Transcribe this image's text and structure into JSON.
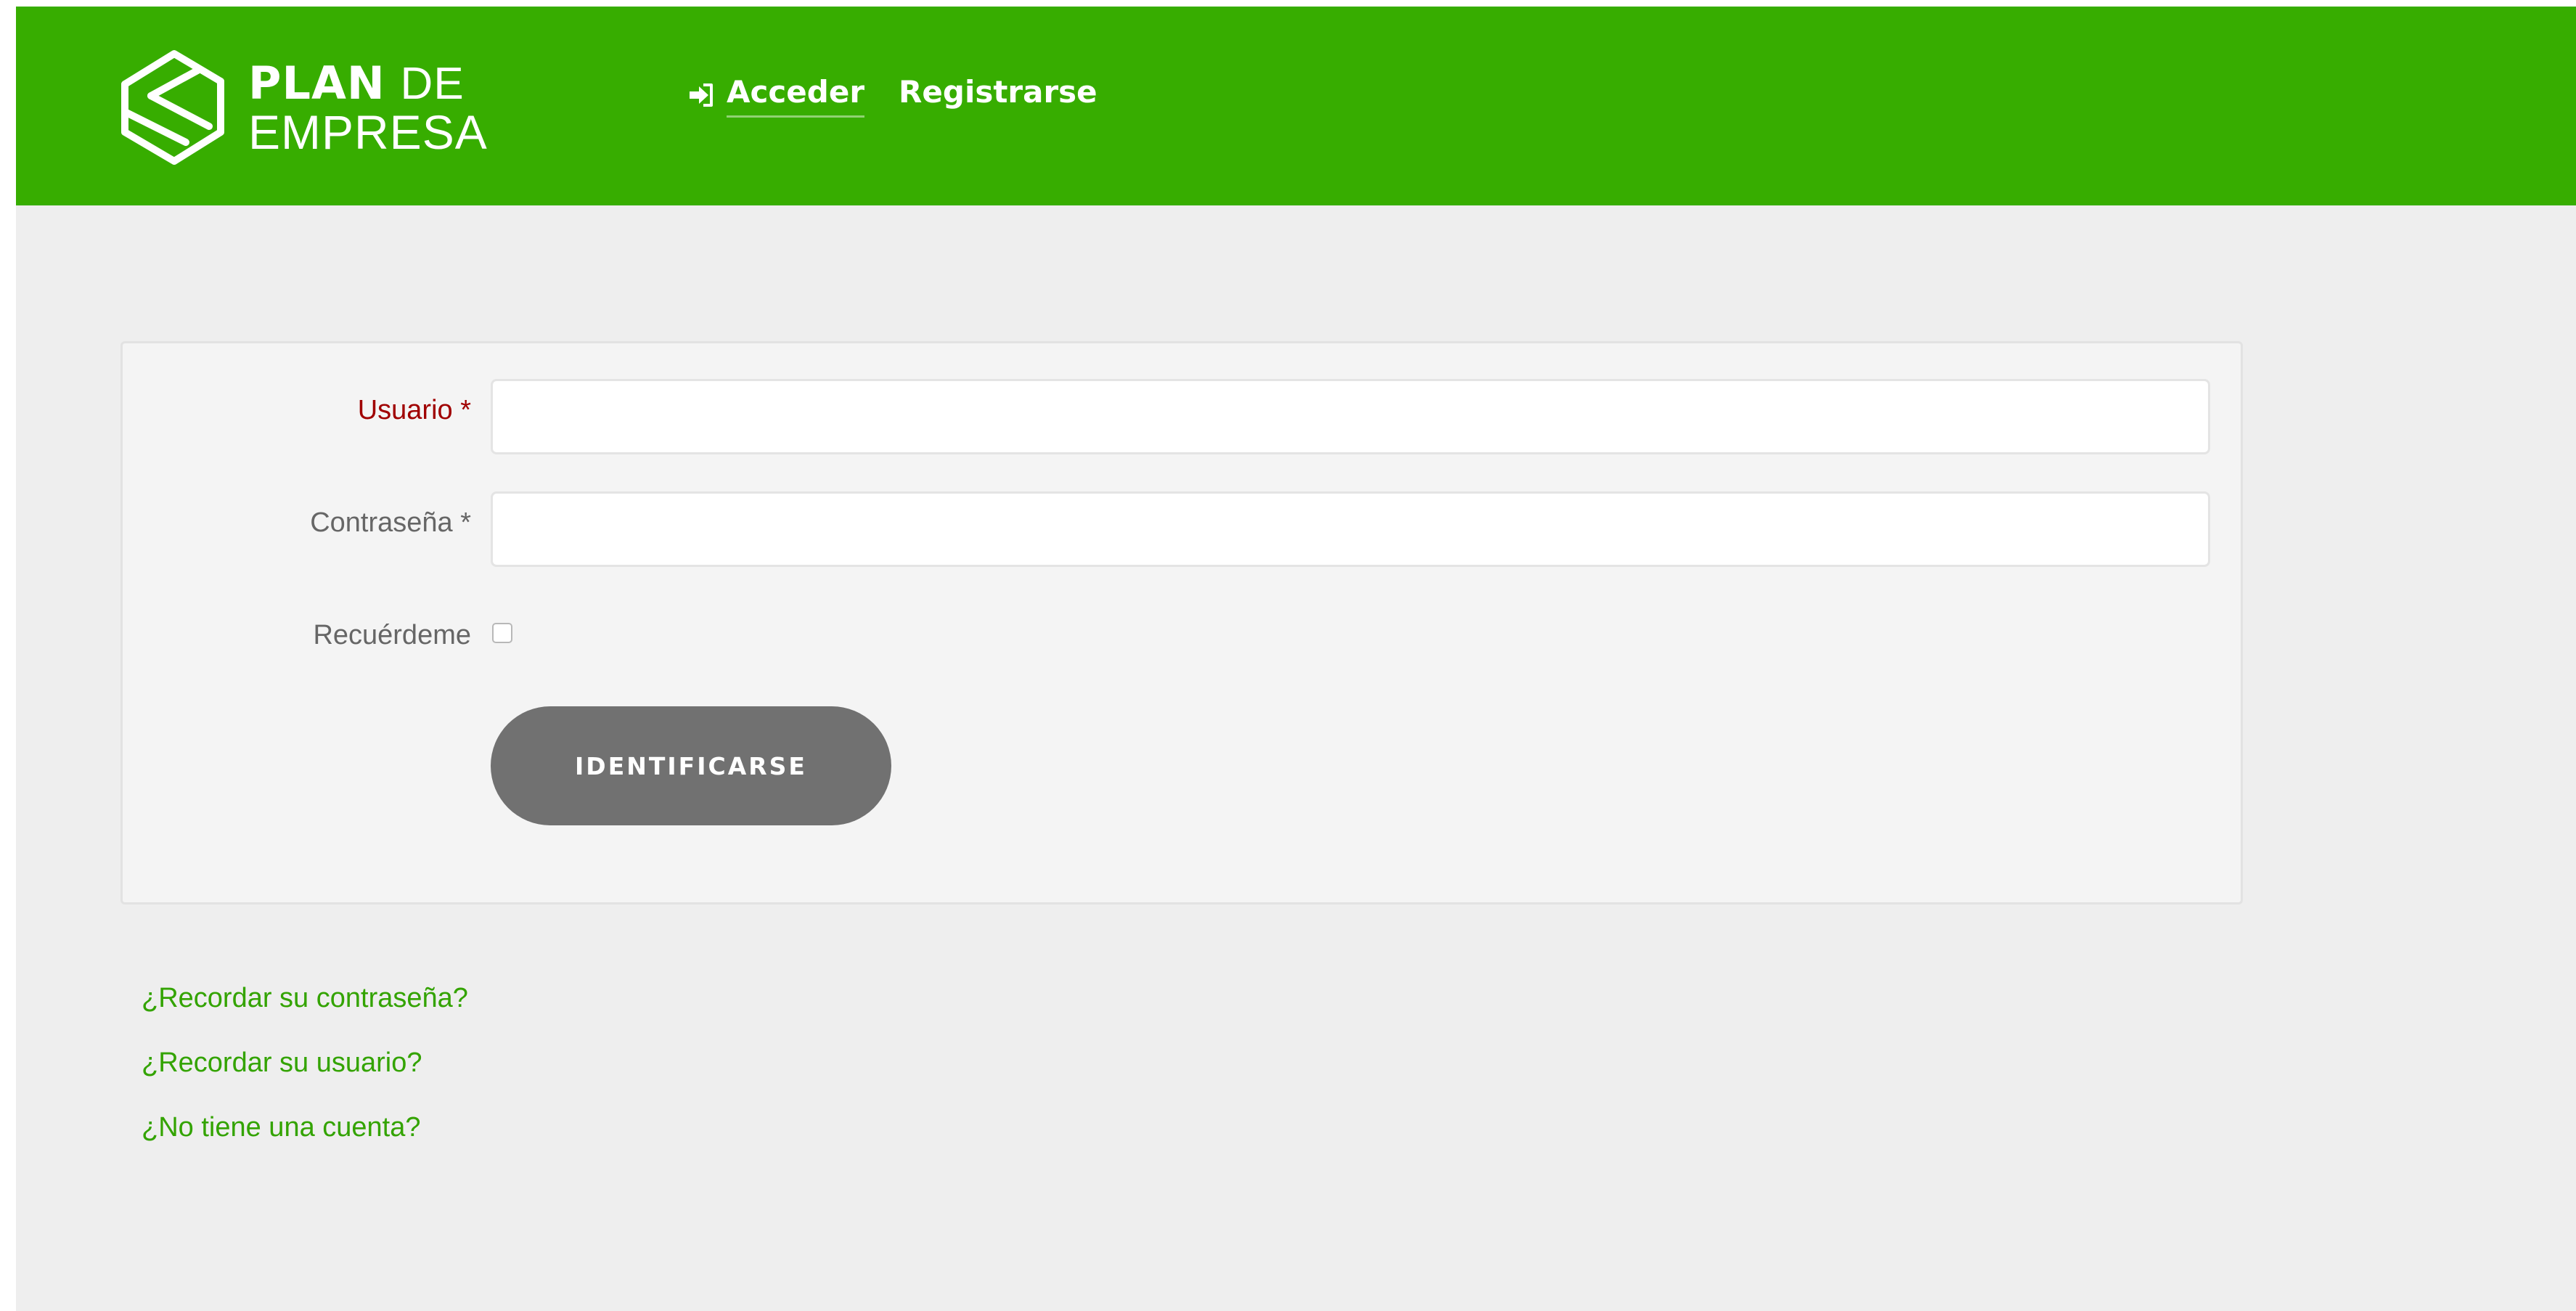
{
  "brand": {
    "line1_bold": "PLAN",
    "line1_light": "DE",
    "line2": "EMPRESA",
    "logo_icon": "box-icon"
  },
  "nav": {
    "login_icon": "sign-in-icon",
    "login_label": "Acceder",
    "register_label": "Registrarse"
  },
  "form": {
    "username_label": "Usuario *",
    "password_label": "Contraseña *",
    "remember_label": "Recuérdeme",
    "username_value": "",
    "password_value": "",
    "remember_checked": false,
    "submit_label": "IDENTIFICARSE"
  },
  "links": [
    {
      "label": "¿Recordar su contraseña?"
    },
    {
      "label": "¿Recordar su usuario?"
    },
    {
      "label": "¿No tiene una cuenta?"
    }
  ],
  "colors": {
    "header_bg": "#37ad00",
    "page_bg": "#eeeeee",
    "panel_bg": "#f4f4f4",
    "link": "#33a300",
    "error_label": "#a00000",
    "button_bg": "#717171"
  }
}
